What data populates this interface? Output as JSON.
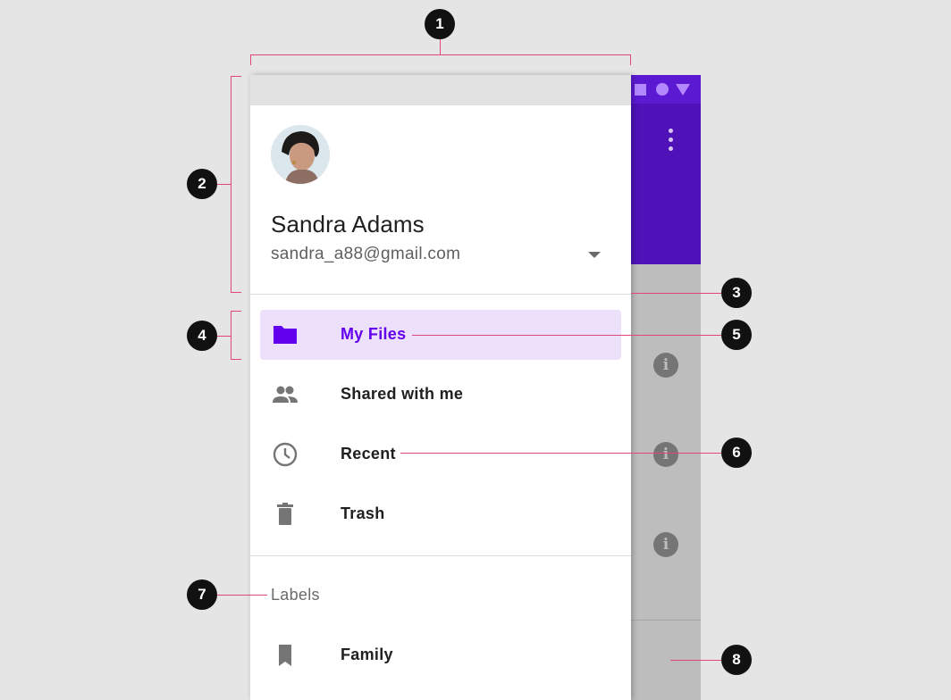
{
  "account": {
    "name": "Sandra Adams",
    "email": "sandra_a88@gmail.com"
  },
  "nav": {
    "items": [
      {
        "label": "My Files",
        "icon": "folder-icon",
        "active": true
      },
      {
        "label": "Shared with me",
        "icon": "people-icon",
        "active": false
      },
      {
        "label": "Recent",
        "icon": "clock-icon",
        "active": false
      },
      {
        "label": "Trash",
        "icon": "trash-icon",
        "active": false
      }
    ],
    "labels_header": "Labels",
    "label_items": [
      {
        "label": "Family",
        "icon": "bookmark-icon"
      }
    ]
  },
  "annotations": [
    "1",
    "2",
    "3",
    "4",
    "5",
    "6",
    "7",
    "8"
  ],
  "colors": {
    "accent": "#6200ee",
    "active_bg": "#ede0fa",
    "app_bar": "#4e12b8",
    "annotation_line": "#e0457b"
  }
}
